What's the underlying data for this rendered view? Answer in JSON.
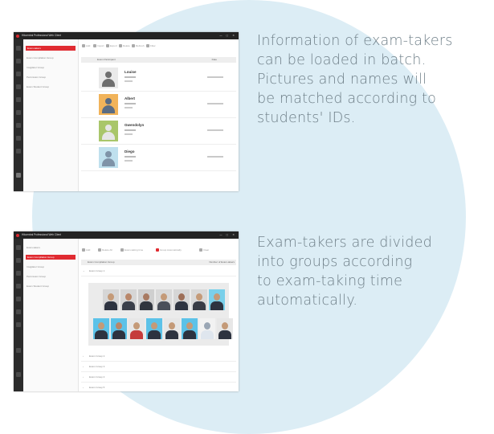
{
  "captions": {
    "first": "Information of exam-takers\ncan be loaded in batch.\nPictures and names will\nbe matched according to\nstudents' IDs.",
    "second": "Exam-takers are divided\ninto groups according\nto exam-taking time\nautomatically."
  },
  "colors": {
    "circle": "#dcedf5",
    "caption_text": "#6f7f88",
    "accent_red": "#e02b31",
    "titlebar": "#232323"
  },
  "window1": {
    "title": "Hikcentral Professional Web Client",
    "nav_items": [
      "Exam-takers",
      "Exam Compilation Group",
      "Invigilator Group",
      "Permission Group",
      "Exam Student Group"
    ],
    "toolbar": [
      "Add",
      "Import",
      "Export",
      "Delete",
      "Refresh",
      "Filter"
    ],
    "table_headers": [
      "Exam Participant",
      "Date"
    ],
    "people": [
      {
        "name": "Louise",
        "photo_color": "#eaeaea"
      },
      {
        "name": "Albert",
        "photo_color": "#f1b35a"
      },
      {
        "name": "Gwendolyn",
        "photo_color": "#a9c66a"
      },
      {
        "name": "Diego",
        "photo_color": "#bfe0ee"
      }
    ]
  },
  "window2": {
    "title": "Hikcentral Professional Web Client",
    "nav_items": [
      "Exam-takers",
      "Exam Compilation Group",
      "Invigilator Group",
      "Permission Group",
      "Exam Student Group"
    ],
    "toolbar": [
      "Add",
      "Delete All",
      "Exam-taking time",
      "Group Automatically",
      "Clear"
    ],
    "table_headers": [
      "Exam Compilation Group",
      "Number of Exam-takers"
    ],
    "groups": [
      "Exam Group 1",
      "Exam Group 2",
      "Exam Group 3",
      "Exam Group 4",
      "Exam Group 5"
    ]
  }
}
